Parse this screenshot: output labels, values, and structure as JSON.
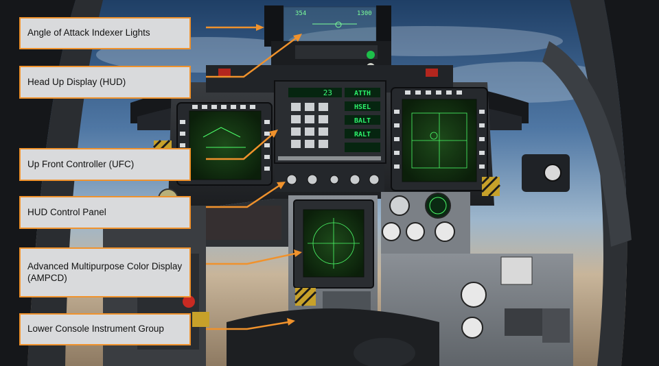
{
  "callouts": [
    {
      "id": "aoa-indexer",
      "label": "Angle of Attack Indexer Lights"
    },
    {
      "id": "hud",
      "label": "Head Up Display (HUD)"
    },
    {
      "id": "ufc",
      "label": "Up Front Controller (UFC)"
    },
    {
      "id": "hud-control-panel",
      "label": "HUD Control Panel"
    },
    {
      "id": "ampcd",
      "label": "Advanced Multipurpose Color Display (AMPCD)"
    },
    {
      "id": "lower-console",
      "label": "Lower Console Instrument Group"
    }
  ],
  "ufc_display": {
    "scratchpad": "23",
    "option_windows": [
      "ATTH",
      "HSEL",
      "BALT",
      "RALT",
      ""
    ]
  },
  "hud_readouts": {
    "heading_left": "354",
    "heading_right": "1300"
  },
  "colors": {
    "callout_border": "#f0922c",
    "callout_fill": "#d9dadc",
    "arrow": "#f0922c",
    "display_green": "#2cf06a"
  }
}
